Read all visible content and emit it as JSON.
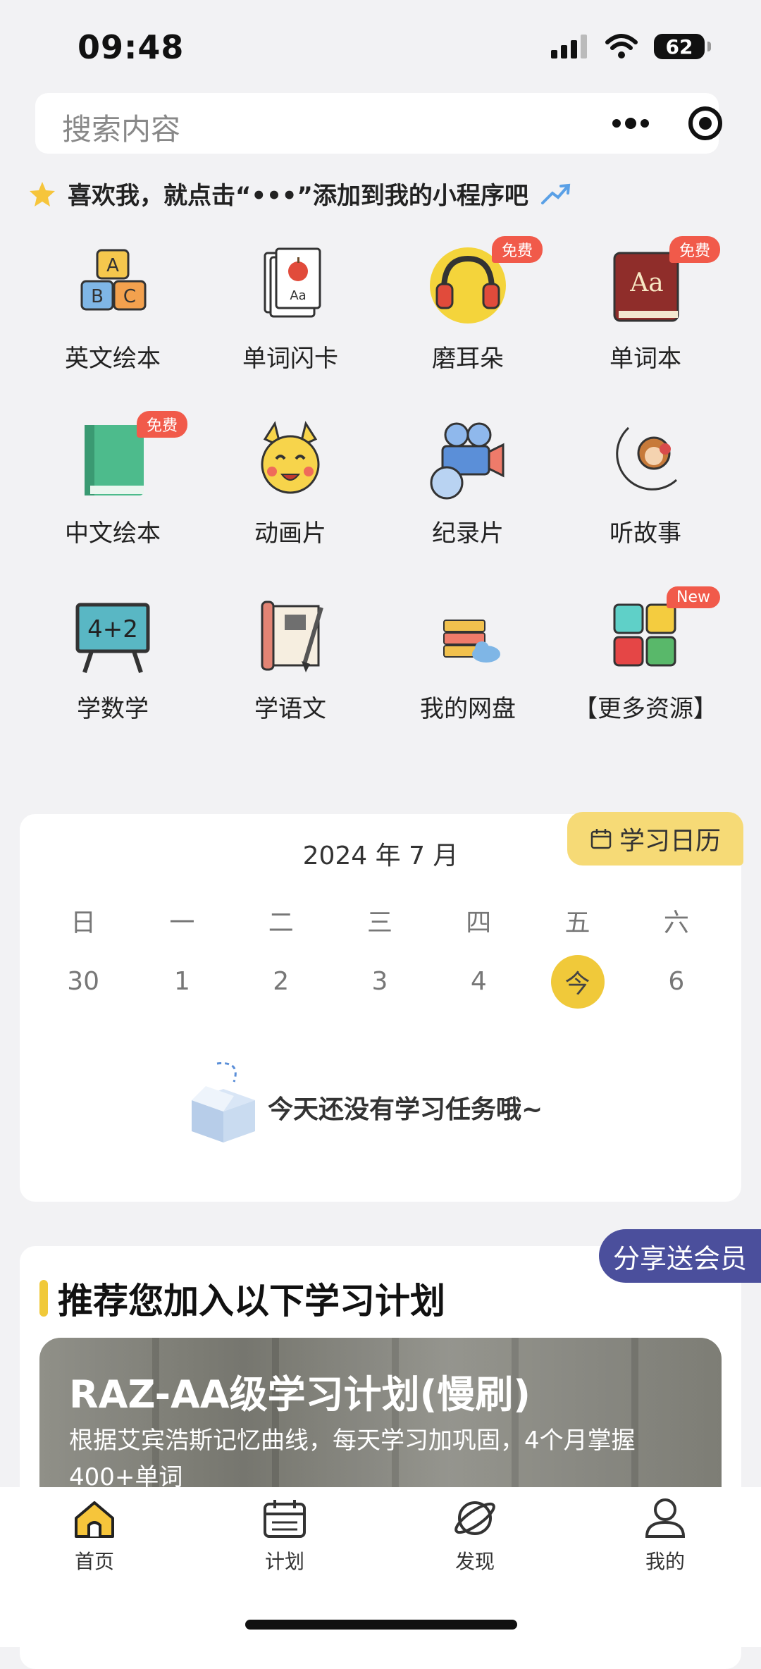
{
  "status_bar": {
    "time": "09:48",
    "battery": "62",
    "icons": [
      "signal-icon",
      "wifi-icon",
      "battery-icon"
    ]
  },
  "search": {
    "placeholder": "搜索内容",
    "more_icon": "more-dots-icon",
    "target_icon": "target-icon"
  },
  "hint": {
    "text": "喜欢我，就点击“•••”添加到我的小程序吧"
  },
  "grid": [
    {
      "label": "英文绘本",
      "icon": "abc-blocks-icon",
      "badge": ""
    },
    {
      "label": "单词闪卡",
      "icon": "flash-cards-icon",
      "badge": ""
    },
    {
      "label": "磨耳朵",
      "icon": "headphones-icon",
      "badge": "免费"
    },
    {
      "label": "单词本",
      "icon": "dictionary-icon",
      "badge": "免费"
    },
    {
      "label": "中文绘本",
      "icon": "green-book-icon",
      "badge": "免费"
    },
    {
      "label": "动画片",
      "icon": "pikachu-icon",
      "badge": ""
    },
    {
      "label": "纪录片",
      "icon": "film-camera-icon",
      "badge": ""
    },
    {
      "label": "听故事",
      "icon": "moon-monkey-icon",
      "badge": ""
    },
    {
      "label": "学数学",
      "icon": "math-board-icon",
      "badge": ""
    },
    {
      "label": "学语文",
      "icon": "scroll-brush-icon",
      "badge": ""
    },
    {
      "label": "我的网盘",
      "icon": "cloud-server-icon",
      "badge": ""
    },
    {
      "label": "【更多资源】",
      "icon": "four-squares-icon",
      "badge": "New"
    }
  ],
  "calendar": {
    "tag_label": "学习日历",
    "month_label": "2024 年 7 月",
    "weekdays": [
      "日",
      "一",
      "二",
      "三",
      "四",
      "五",
      "六"
    ],
    "days": [
      "30",
      "1",
      "2",
      "3",
      "4",
      "今",
      "6"
    ],
    "empty_message": "今天还没有学习任务哦~"
  },
  "plans": {
    "share_label": "分享送会员",
    "title": "推荐您加入以下学习计划",
    "card": {
      "title": "RAZ-AA级学习计划(慢刷)",
      "description": "根据艾宾浩斯记忆曲线，每天学习加巩固，4个月掌握400+单词"
    }
  },
  "tabbar": [
    {
      "label": "首页",
      "icon": "home-icon"
    },
    {
      "label": "计划",
      "icon": "calendar-icon"
    },
    {
      "label": "发现",
      "icon": "planet-icon"
    },
    {
      "label": "我的",
      "icon": "person-icon"
    }
  ],
  "colors": {
    "accent": "#f0c93a",
    "badge": "#f15a4a",
    "share": "#4b4f9c",
    "background": "#f2f2f4"
  }
}
